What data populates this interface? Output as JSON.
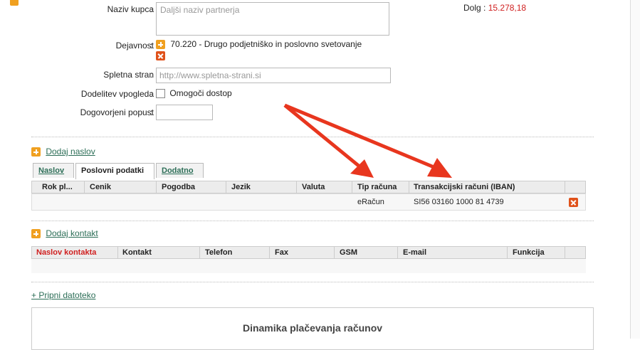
{
  "form": {
    "naziv_kupca": {
      "label": "Naziv kupca",
      "placeholder": "Daljši naziv partnerja"
    },
    "dejavnost": {
      "label": "Dejavnost",
      "value": "70.220 - Drugo podjetniško in poslovno svetovanje"
    },
    "spletna_stran": {
      "label": "Spletna stran",
      "placeholder": "http://www.spletna-strani.si"
    },
    "dodelitev": {
      "label": "Dodelitev vpogleda",
      "checkbox_label": "Omogoči dostop"
    },
    "popust": {
      "label": "Dogovorjeni popust",
      "value": ""
    }
  },
  "dolg": {
    "label": "Dolg",
    "value": "15.278,18"
  },
  "colon": ":",
  "address": {
    "add_link": "Dodaj naslov",
    "tabs": [
      "Naslov",
      "Poslovni podatki",
      "Dodatno"
    ],
    "columns": [
      "Rok pl...",
      "Cenik",
      "Pogodba",
      "Jezik",
      "Valuta",
      "Tip računa",
      "Transakcijski računi (IBAN)"
    ],
    "row": {
      "tip_racuna": "eRačun",
      "iban": "SI56 03160 1000 81 4739"
    }
  },
  "contact": {
    "add_link": "Dodaj kontakt",
    "columns": [
      "Naslov kontakta",
      "Kontakt",
      "Telefon",
      "Fax",
      "GSM",
      "E-mail",
      "Funkcija"
    ]
  },
  "attach_link": "+ Pripni datoteko",
  "chart": {
    "title": "Dinamika plačevanja računov"
  },
  "colors": {
    "accent_link": "#2c6e57",
    "debt_red": "#d02020",
    "plus_orange": "#f0a020",
    "delete_orange": "#e0521b",
    "arrow_red": "#e8361e"
  }
}
